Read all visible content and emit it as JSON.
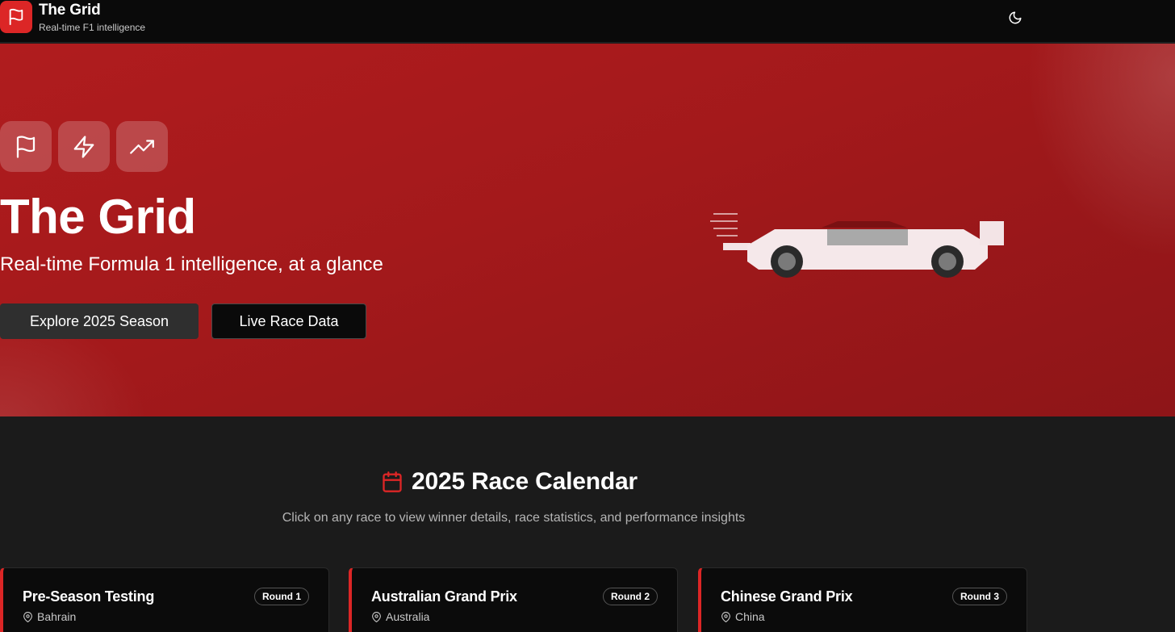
{
  "app": {
    "title": "The Grid",
    "subtitle": "Real-time F1 intelligence"
  },
  "header": {
    "logo_icon": "flag-icon",
    "theme_toggle_icon": "moon-icon"
  },
  "hero": {
    "icons": [
      "flag-icon",
      "zap-icon",
      "trending-up-icon"
    ],
    "title": "The Grid",
    "subtitle": "Real-time Formula 1 intelligence, at a glance",
    "primary_button": "Explore 2025 Season",
    "secondary_button": "Live Race Data",
    "illustration": "race-car-icon"
  },
  "calendar": {
    "icon": "calendar-icon",
    "title": "2025 Race Calendar",
    "subtitle": "Click on any race to view winner details, race statistics, and performance insights",
    "races": [
      {
        "name": "Pre-Season Testing",
        "round": "Round 1",
        "location": "Bahrain"
      },
      {
        "name": "Australian Grand Prix",
        "round": "Round 2",
        "location": "Australia"
      },
      {
        "name": "Chinese Grand Prix",
        "round": "Round 3",
        "location": "China"
      }
    ]
  },
  "colors": {
    "accent": "#dc2626",
    "hero_red": "#a3191b",
    "header_bg": "#0a0a0a",
    "page_bg": "#1b1b1b"
  }
}
